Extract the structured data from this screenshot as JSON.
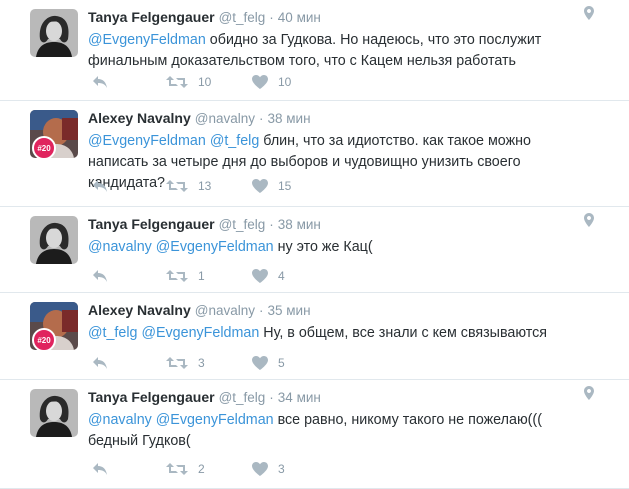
{
  "tweets": [
    {
      "author": "Tanya Felgengauer",
      "handle": "@t_felg",
      "sep": "·",
      "time": "40 мин",
      "mentions": [
        "@EvgenyFeldman"
      ],
      "text": " обидно за Гудкова. Но надеюсь, что это послужит финальным доказательством того, что с Кацем нельзя работать",
      "retweets": "10",
      "likes": "10",
      "geo": true,
      "avatar": "tanya"
    },
    {
      "author": "Alexey Navalny",
      "handle": "@navalny",
      "sep": "·",
      "time": "38 мин",
      "mentions": [
        "@EvgenyFeldman",
        "@t_felg"
      ],
      "text": " блин, что за идиотство. как такое можно написать за четыре дня до выборов и чудовищно унизить своего кандидата?",
      "retweets": "13",
      "likes": "15",
      "geo": false,
      "avatar": "navalny",
      "badge": "#20"
    },
    {
      "author": "Tanya Felgengauer",
      "handle": "@t_felg",
      "sep": "·",
      "time": "38 мин",
      "mentions": [
        "@navalny",
        "@EvgenyFeldman"
      ],
      "text": " ну это же Кац(",
      "retweets": "1",
      "likes": "4",
      "geo": true,
      "avatar": "tanya"
    },
    {
      "author": "Alexey Navalny",
      "handle": "@navalny",
      "sep": "·",
      "time": "35 мин",
      "mentions": [
        "@t_felg",
        "@EvgenyFeldman"
      ],
      "text": " Ну, в общем, все знали с кем связываются",
      "retweets": "3",
      "likes": "5",
      "geo": false,
      "avatar": "navalny",
      "badge": "#20"
    },
    {
      "author": "Tanya Felgengauer",
      "handle": "@t_felg",
      "sep": "·",
      "time": "34 мин",
      "mentions": [
        "@navalny",
        "@EvgenyFeldman"
      ],
      "text": " все равно, никому такого не пожелаю((( бедный Гудков(",
      "retweets": "2",
      "likes": "3",
      "geo": true,
      "avatar": "tanya"
    }
  ],
  "colors": {
    "mention": "#3b94d9",
    "icon": "#aab8c2",
    "badge": "#e0245e"
  }
}
